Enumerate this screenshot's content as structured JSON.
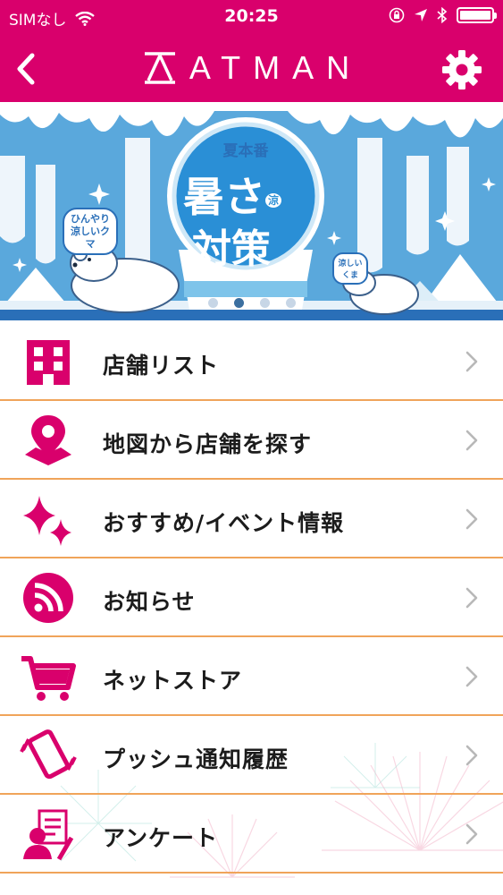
{
  "status_bar": {
    "carrier": "SIMなし",
    "time": "20:25"
  },
  "nav": {
    "logo_text": "ATMAN",
    "back_icon": "chevron-left-icon",
    "settings_icon": "gear-icon"
  },
  "banner": {
    "badge_title": "夏本番",
    "badge_line1": "暑さ",
    "badge_small": "涼",
    "badge_line2": "対策",
    "bubble_left_line1": "ひんやり",
    "bubble_left_line2": "涼しいクマ",
    "bubble_right": "涼しいくま",
    "slide_count": 4,
    "active_slide": 1
  },
  "colors": {
    "brand": "#d9006c",
    "separator": "#f0a45a",
    "banner_blue": "#2a6fb8"
  },
  "menu": [
    {
      "label": "店舗リスト",
      "icon": "building-icon"
    },
    {
      "label": "地図から店舗を探す",
      "icon": "map-pin-icon"
    },
    {
      "label": "おすすめ/イベント情報",
      "icon": "sparkle-icon"
    },
    {
      "label": "お知らせ",
      "icon": "rss-icon"
    },
    {
      "label": "ネットストア",
      "icon": "cart-icon"
    },
    {
      "label": "プッシュ通知履歴",
      "icon": "phone-vibrate-icon"
    },
    {
      "label": "アンケート",
      "icon": "survey-icon"
    }
  ]
}
